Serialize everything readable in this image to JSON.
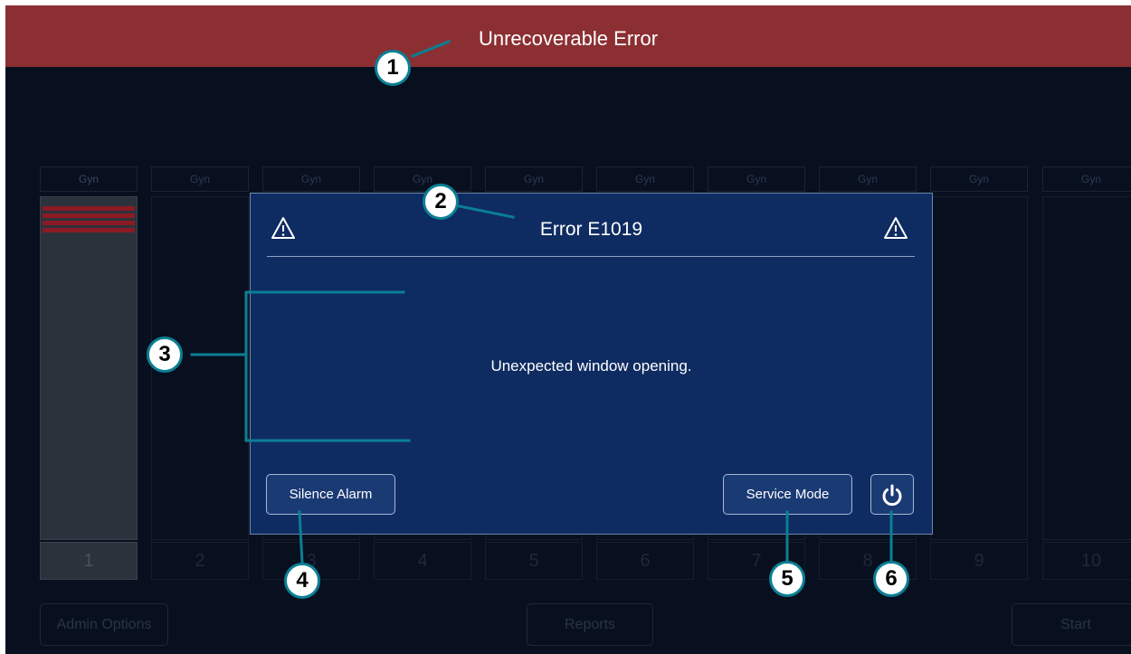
{
  "banner": {
    "title": "Unrecoverable Error"
  },
  "bays": [
    {
      "label": "Gyn",
      "number": "1"
    },
    {
      "label": "Gyn",
      "number": "2"
    },
    {
      "label": "Gyn",
      "number": "3"
    },
    {
      "label": "Gyn",
      "number": "4"
    },
    {
      "label": "Gyn",
      "number": "5"
    },
    {
      "label": "Gyn",
      "number": "6"
    },
    {
      "label": "Gyn",
      "number": "7"
    },
    {
      "label": "Gyn",
      "number": "8"
    },
    {
      "label": "Gyn",
      "number": "9"
    },
    {
      "label": "Gyn",
      "number": "10"
    }
  ],
  "footer": {
    "admin_label": "Admin Options",
    "reports_label": "Reports",
    "start_label": "Start"
  },
  "dialog": {
    "title": "Error E1019",
    "message": "Unexpected window opening.",
    "silence_label": "Silence Alarm",
    "service_label": "Service Mode",
    "warning_icon": "warning-triangle-icon",
    "power_icon": "power-icon"
  },
  "callouts": [
    "1",
    "2",
    "3",
    "4",
    "5",
    "6"
  ],
  "colors": {
    "banner": "#8b2f33",
    "background": "#08101f",
    "dialog": "#0e2c61",
    "callout_line": "#0b7f94",
    "alarm_red": "#8b1a22"
  }
}
